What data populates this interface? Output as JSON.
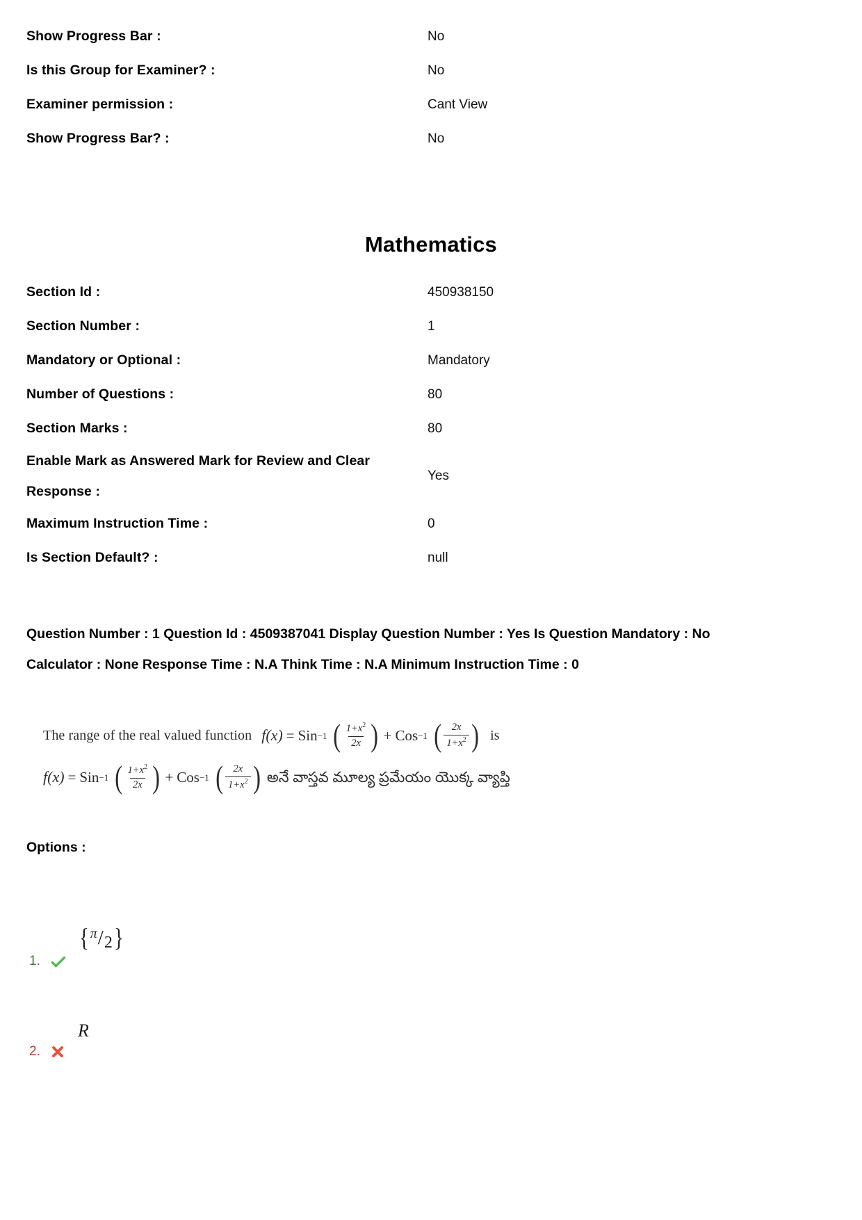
{
  "document": {
    "top_properties": [
      {
        "label": "Show Progress Bar :",
        "value": "No"
      },
      {
        "label": "Is this Group for Examiner? :",
        "value": "No"
      },
      {
        "label": "Examiner permission :",
        "value": "Cant View"
      },
      {
        "label": "Show Progress Bar? :",
        "value": "No"
      }
    ],
    "section_title": "Mathematics",
    "section_properties": [
      {
        "label": "Section Id :",
        "value": "450938150"
      },
      {
        "label": "Section Number :",
        "value": "1"
      },
      {
        "label": "Mandatory or Optional :",
        "value": "Mandatory"
      },
      {
        "label": "Number of Questions :",
        "value": "80"
      },
      {
        "label": "Section Marks :",
        "value": "80"
      },
      {
        "label": "Enable Mark as Answered Mark for Review and Clear Response :",
        "value": "Yes"
      },
      {
        "label": "Maximum Instruction Time :",
        "value": "0"
      },
      {
        "label": "Is Section Default? :",
        "value": "null"
      }
    ],
    "question": {
      "meta_text": "Question Number : 1 Question Id : 4509387041 Display Question Number : Yes Is Question Mandatory : No Calculator : None Response Time : N.A Think Time : N.A Minimum Instruction Time : 0",
      "meta_fields": {
        "question_number": "1",
        "question_id": "4509387041",
        "display_question_number": "Yes",
        "is_question_mandatory": "No",
        "calculator": "None",
        "response_time": "N.A",
        "think_time": "N.A",
        "minimum_instruction_time": "0"
      },
      "stem_english": {
        "lead": "The range of the real valued function",
        "fx": "f(x)",
        "equals": "=",
        "sin_label": "Sin",
        "sin_exp": "−1",
        "frac1_num": "1+x",
        "frac1_num_sup": "2",
        "frac1_den": "2x",
        "plus": "+",
        "cos_label": "Cos",
        "cos_exp": "−1",
        "frac2_num": "2x",
        "frac2_den": "1+x",
        "frac2_den_sup": "2",
        "trailing": "is"
      },
      "stem_telugu": {
        "fx": "f(x)",
        "equals": "=",
        "sin_label": "Sin",
        "sin_exp": "−1",
        "frac1_num": "1+x",
        "frac1_num_sup": "2",
        "frac1_den": "2x",
        "plus": "+",
        "cos_label": "Cos",
        "cos_exp": "−1",
        "frac2_num": "2x",
        "frac2_den": "1+x",
        "frac2_den_sup": "2",
        "text": "అనే వాస్తవ మూల్య ప్రమేయం యొక్క వ్యాప్తి"
      },
      "options_label": "Options :",
      "options": [
        {
          "index": "1.",
          "mark": "check-icon",
          "status": "correct",
          "value": "{π/2}",
          "brace_open": "{",
          "numerator": "π",
          "slash": "/",
          "denominator": "2",
          "brace_close": "}"
        },
        {
          "index": "2.",
          "mark": "cross-icon",
          "status": "wrong",
          "value": "R"
        }
      ]
    }
  },
  "colors": {
    "correct_green": "#5cb85c",
    "wrong_red": "#e8503a",
    "index_green": "#3a7d32",
    "index_red": "#c0392b",
    "text_black": "#000000",
    "math_gray": "#2b2b2b",
    "page_background": "#ffffff"
  }
}
